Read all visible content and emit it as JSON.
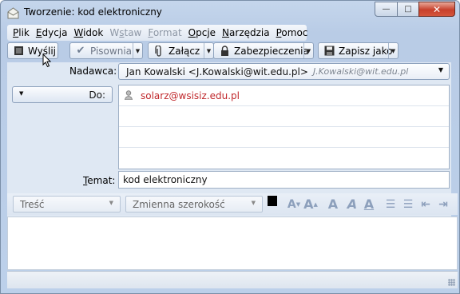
{
  "window": {
    "title": "Tworzenie: kod elektroniczny"
  },
  "menu": [
    {
      "label": "Plik",
      "underline": "P",
      "rest": "lik",
      "enabled": true
    },
    {
      "label": "Edycja",
      "underline": "E",
      "rest": "dycja",
      "enabled": true
    },
    {
      "label": "Widok",
      "underline": "W",
      "rest": "idok",
      "enabled": true
    },
    {
      "label": "Wstaw",
      "underline": "s",
      "pre": "W",
      "rest": "taw",
      "enabled": false
    },
    {
      "label": "Format",
      "underline": "F",
      "rest": "ormat",
      "enabled": false
    },
    {
      "label": "Opcje",
      "underline": "O",
      "rest": "pcje",
      "enabled": true
    },
    {
      "label": "Narzędzia",
      "underline": "N",
      "rest": "arzędzia",
      "enabled": true
    },
    {
      "label": "Pomoc",
      "underline": "P",
      "rest": "omoc",
      "enabled": true
    }
  ],
  "toolbar": {
    "send": "Wyślij",
    "spell": "Pisownia",
    "attach": "Załącz",
    "security": "Zabezpieczenia",
    "save": "Zapisz jako"
  },
  "header": {
    "sender_label": "Nadawca:",
    "sender_name": "Jan Kowalski <J.Kowalski@wit.edu.pl>",
    "sender_account": "J.Kowalski@wit.edu.pl",
    "to_label": "Do:",
    "recipients": [
      "solarz@wsisiz.edu.pl",
      "",
      "",
      ""
    ],
    "subject_label": "Temat:",
    "subject": "kod elektroniczny"
  },
  "format": {
    "paragraph": "Treść",
    "font": "Zmienna szerokość"
  },
  "colors": {
    "recipient_text": "#c0282c",
    "close_button": "#c7402b"
  }
}
